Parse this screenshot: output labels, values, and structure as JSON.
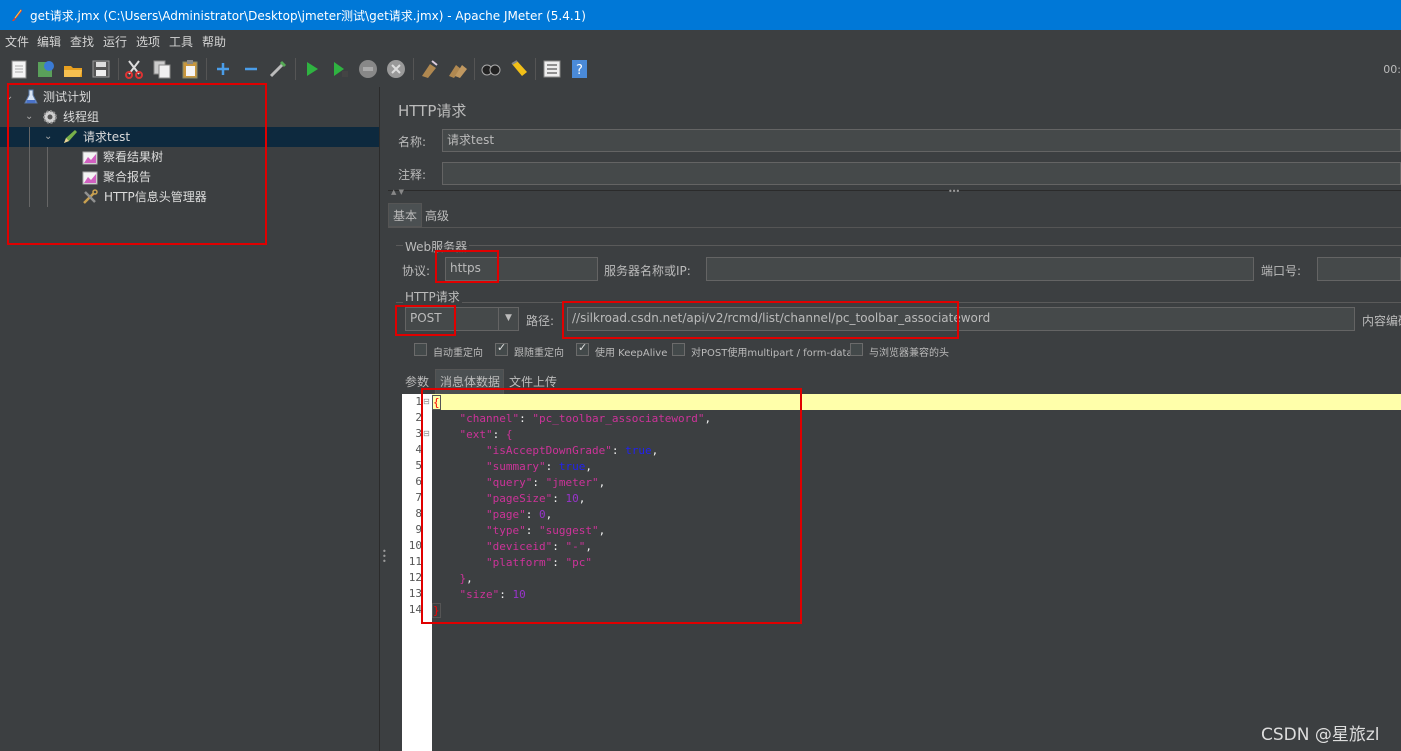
{
  "window": {
    "title": "get请求.jmx (C:\\Users\\Administrator\\Desktop\\jmeter测试\\get请求.jmx) - Apache JMeter (5.4.1)"
  },
  "menu": [
    "文件",
    "编辑",
    "查找",
    "运行",
    "选项",
    "工具",
    "帮助"
  ],
  "toolbar": {
    "timer": "00:",
    "icons": [
      "new-icon",
      "templates-icon",
      "open-icon",
      "save-icon",
      "cut-icon",
      "copy-icon",
      "paste-icon",
      "expand-icon",
      "collapse-icon",
      "toggle-icon",
      "start-icon",
      "start-no-pause-icon",
      "stop-icon",
      "shutdown-icon",
      "clear-icon",
      "clear-all-icon",
      "search-icon",
      "reset-search-icon",
      "function-helper-icon",
      "help-icon"
    ]
  },
  "tree": {
    "items": [
      {
        "label": "测试计划",
        "icon": "flask-icon"
      },
      {
        "label": "线程组",
        "icon": "gear-icon"
      },
      {
        "label": "请求test",
        "icon": "pencil-icon"
      },
      {
        "label": "察看结果树",
        "icon": "chart-icon"
      },
      {
        "label": "聚合报告",
        "icon": "chart-icon"
      },
      {
        "label": "HTTP信息头管理器",
        "icon": "wrench-icon"
      }
    ]
  },
  "panel": {
    "heading": "HTTP请求",
    "name_label": "名称:",
    "name_value": "请求test",
    "comment_label": "注释:",
    "comment_value": "",
    "tabs": [
      "基本",
      "高级"
    ],
    "web_server_legend": "Web服务器",
    "protocol_label": "协议:",
    "protocol_value": "https",
    "server_label": "服务器名称或IP:",
    "server_value": "",
    "port_label": "端口号:",
    "port_value": "",
    "http_request_legend": "HTTP请求",
    "method_value": "POST",
    "path_label": "路径:",
    "path_value": "//silkroad.csdn.net/api/v2/rcmd/list/channel/pc_toolbar_associateword",
    "encoding_label": "内容编码",
    "checkboxes": [
      {
        "label": "自动重定向",
        "checked": false
      },
      {
        "label": "跟随重定向",
        "checked": true
      },
      {
        "label": "使用 KeepAlive",
        "checked": true
      },
      {
        "label": "对POST使用multipart / form-data",
        "checked": false
      },
      {
        "label": "与浏览器兼容的头",
        "checked": false
      }
    ],
    "body_tabs": [
      "参数",
      "消息体数据",
      "文件上传"
    ]
  },
  "editor": {
    "line_numbers": [
      "1",
      "2",
      "3",
      "4",
      "5",
      "6",
      "7",
      "8",
      "9",
      "10",
      "11",
      "12",
      "13",
      "14"
    ],
    "lines": [
      "{",
      "    \"channel\": \"pc_toolbar_associateword\",",
      "    \"ext\": {",
      "        \"isAcceptDownGrade\": true,",
      "        \"summary\": true,",
      "        \"query\": \"jmeter\",",
      "        \"pageSize\": 10,",
      "        \"page\": 0,",
      "        \"type\": \"suggest\",",
      "        \"deviceid\": \"-\",",
      "        \"platform\": \"pc\"",
      "    },",
      "    \"size\": 10",
      "}"
    ]
  },
  "watermark": "CSDN @星旅zl",
  "colors": {
    "key": "#cc3399",
    "string": "#cc3399",
    "keyword": "#2222ee",
    "number": "#9933cc",
    "punct": "#f0f0f0",
    "highlight": "#ff0000"
  }
}
